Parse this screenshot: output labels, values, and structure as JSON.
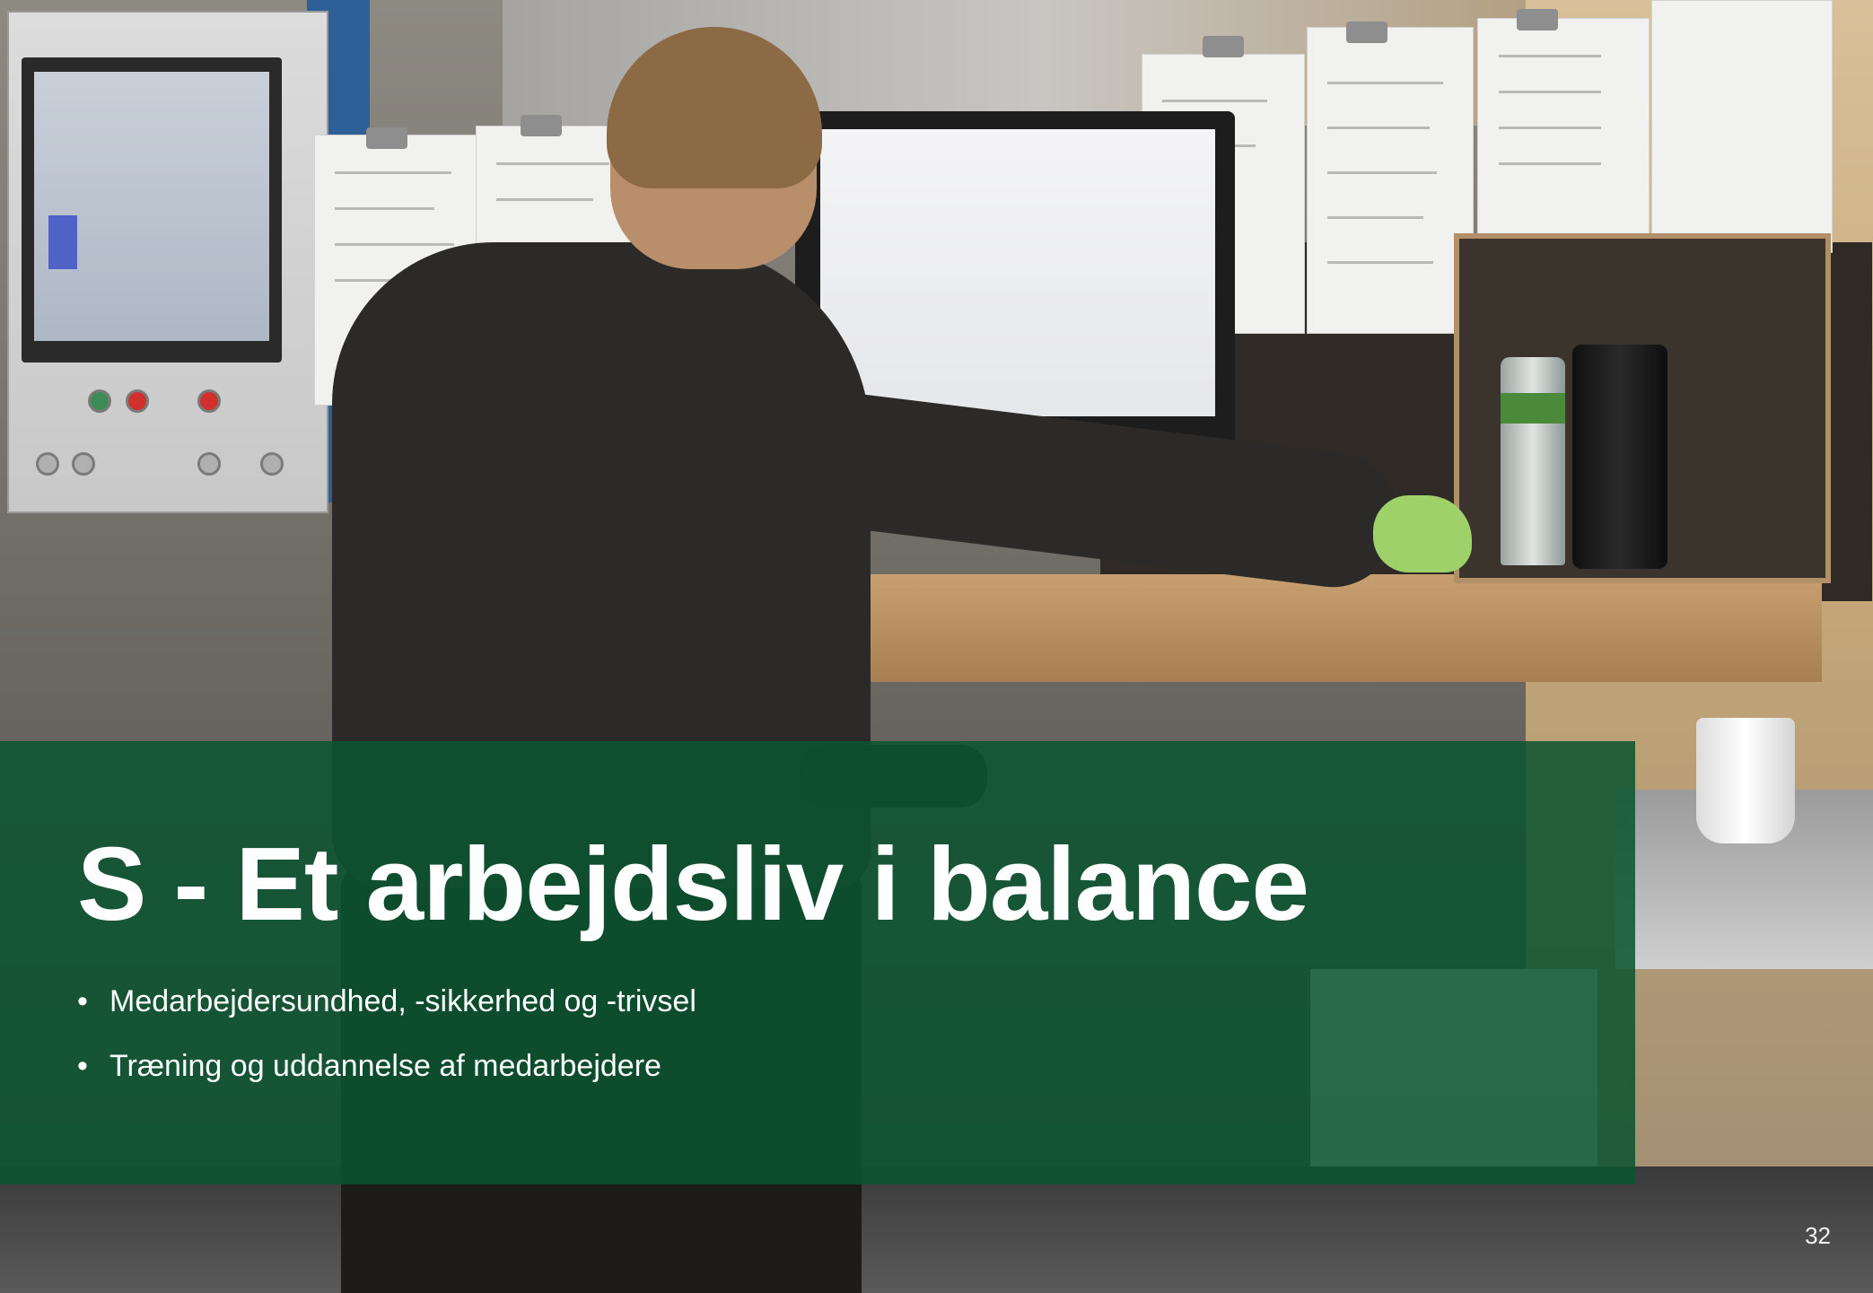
{
  "slide": {
    "title": "S - Et arbejdsliv i balance",
    "bullets": [
      "Medarbejdersundhed, -sikkerhed og -trivsel",
      "Træning og uddannelse af medarbejdere"
    ],
    "bullet_marker": "•",
    "page_number": "32"
  },
  "colors": {
    "overlay_green": "#0a5430",
    "text": "#ffffff"
  }
}
